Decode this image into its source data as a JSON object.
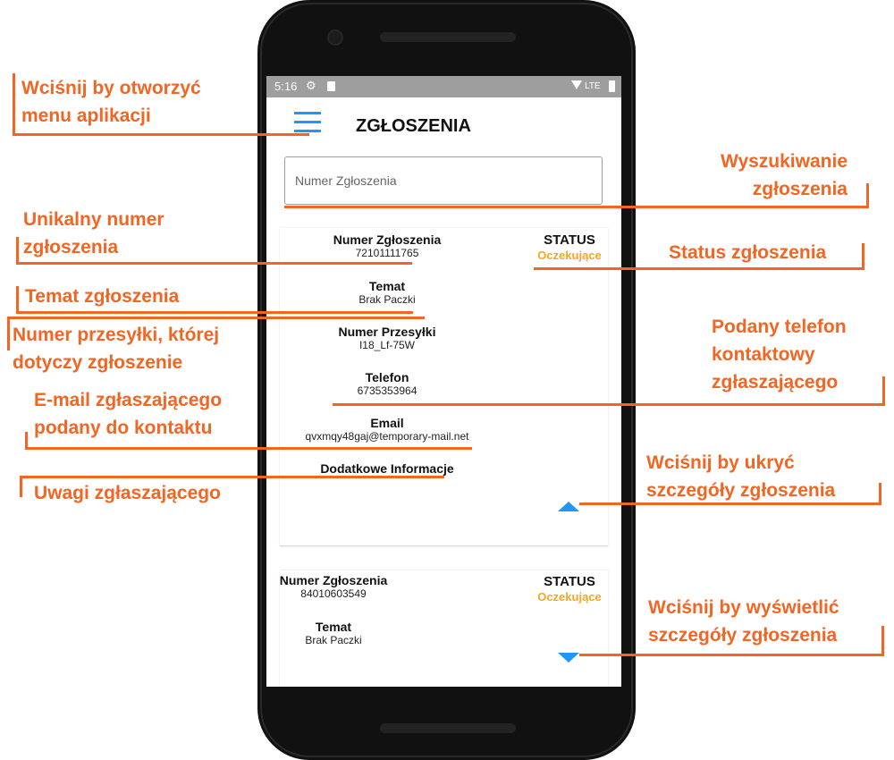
{
  "phone": {
    "statusbar": {
      "time": "5:16",
      "network": "LTE"
    },
    "appbar": {
      "title": "ZGŁOSZENIA",
      "menu_icon": "hamburger-menu-icon"
    },
    "search": {
      "placeholder": "Numer Zgłoszenia"
    },
    "tickets": [
      {
        "number_label": "Numer Zgłoszenia",
        "number": "72101111765",
        "status_label": "STATUS",
        "status": "Oczekujące",
        "subject_label": "Temat",
        "subject": "Brak Paczki",
        "parcel_label": "Numer Przesyłki",
        "parcel": "I18_Lf-75W",
        "phone_label": "Telefon",
        "phone": "6735353964",
        "email_label": "Email",
        "email": "qvxmqy48gaj@temporary-mail.net",
        "notes_label": "Dodatkowe Informacje",
        "toggle_icon": "collapse-arrow-icon"
      },
      {
        "number_label": "Numer Zgłoszenia",
        "number": "84010603549",
        "status_label": "STATUS",
        "status": "Oczekujące",
        "subject_label": "Temat",
        "subject": "Brak Paczki",
        "toggle_icon": "expand-arrow-icon"
      }
    ],
    "colors": {
      "accent": "#2196f3",
      "status": "#f5a623",
      "statusbar": "#9e9e9e"
    }
  },
  "annotations": {
    "menu": [
      "Wciśnij by otworzyć",
      "menu aplikacji"
    ],
    "search": [
      "Wyszukiwanie",
      "zgłoszenia"
    ],
    "number": [
      "Unikalny numer",
      "zgłoszenia"
    ],
    "status": "Status zgłoszenia",
    "subject": "Temat zgłoszenia",
    "parcel": [
      "Numer przesyłki, której",
      "dotyczy zgłoszenie"
    ],
    "phone": [
      "Podany telefon",
      "kontaktowy",
      "zgłaszającego"
    ],
    "email": [
      "E-mail zgłaszającego",
      "podany do kontaktu"
    ],
    "hide": [
      "Wciśnij by ukryć",
      "szczegóły zgłoszenia"
    ],
    "notes": "Uwagi zgłaszającego",
    "show": [
      "Wciśnij by wyświetlić",
      "szczegóły zgłoszenia"
    ],
    "color": "#f26522"
  }
}
